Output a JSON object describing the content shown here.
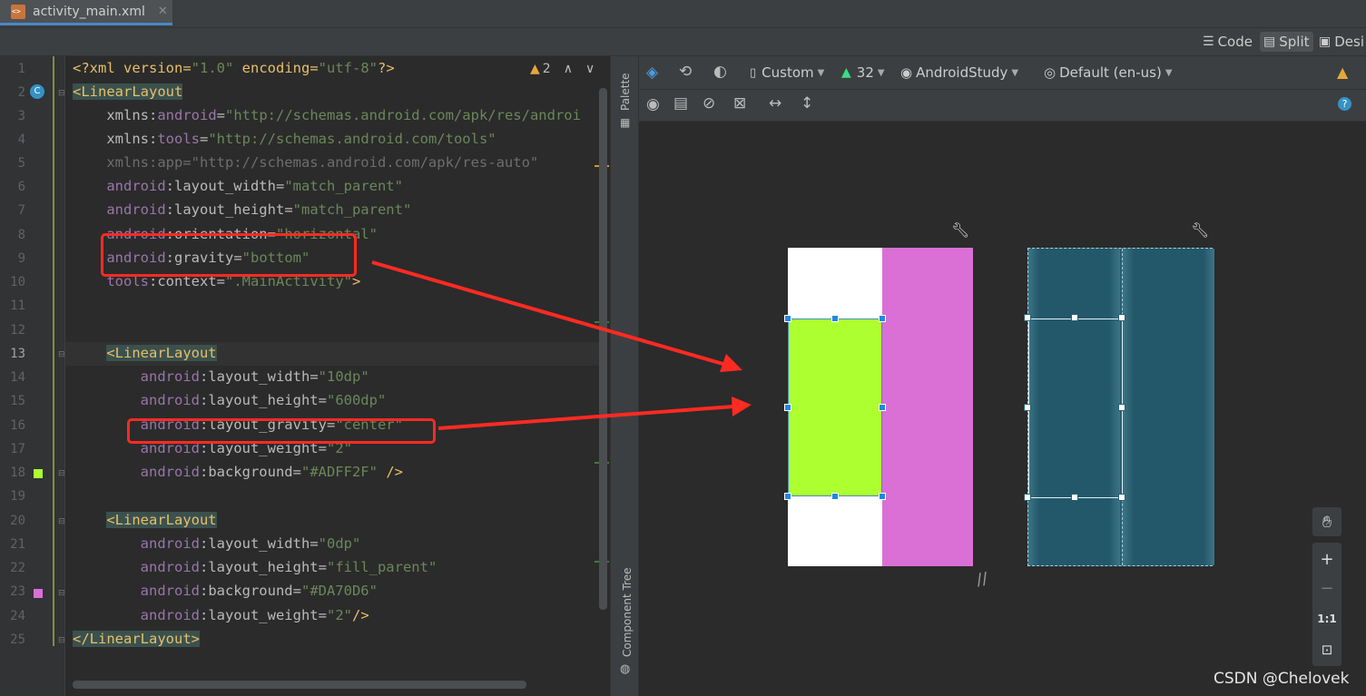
{
  "tab": {
    "filename": "activity_main.xml",
    "close": "✕"
  },
  "modes": {
    "code": "Code",
    "split": "Split",
    "design": "Desi"
  },
  "inspection": {
    "count": "2"
  },
  "lines": [
    "1",
    "2",
    "3",
    "4",
    "5",
    "6",
    "7",
    "8",
    "9",
    "10",
    "11",
    "12",
    "13",
    "14",
    "15",
    "16",
    "17",
    "18",
    "19",
    "20",
    "21",
    "22",
    "23",
    "24",
    "25"
  ],
  "code": {
    "l1": {
      "a": "<?xml version=",
      "b": "\"1.0\"",
      "c": " encoding=",
      "d": "\"utf-8\"",
      "e": "?>"
    },
    "l2": {
      "tag": "<LinearLayout"
    },
    "l3": {
      "ns": "xmlns:",
      "attr": "android",
      "eq": "=",
      "val": "\"http://schemas.android.com/apk/res/androi"
    },
    "l4": {
      "ns": "xmlns:",
      "attr": "tools",
      "eq": "=",
      "val": "\"http://schemas.android.com/tools\""
    },
    "l5": {
      "text": "xmlns:app=\"http://schemas.android.com/apk/res-auto\""
    },
    "l6": {
      "ns": "android",
      "attr": ":layout_width",
      "eq": "=",
      "val": "\"match_parent\""
    },
    "l7": {
      "ns": "android",
      "attr": ":layout_height",
      "eq": "=",
      "val": "\"match_parent\""
    },
    "l8": {
      "ns": "android",
      "attr": ":orientation",
      "eq": "=",
      "val": "\"horizontal\""
    },
    "l9": {
      "ns": "android",
      "attr": ":gravity",
      "eq": "=",
      "val": "\"bottom\""
    },
    "l10": {
      "ns": "tools",
      "attr": ":context",
      "eq": "=",
      "val": "\".MainActivity\"",
      "end": ">"
    },
    "l13": {
      "tag": "<LinearLayout"
    },
    "l14": {
      "ns": "android",
      "attr": ":layout_width",
      "eq": "=",
      "val": "\"10dp\""
    },
    "l15": {
      "ns": "android",
      "attr": ":layout_height",
      "eq": "=",
      "val": "\"600dp\""
    },
    "l16": {
      "ns": "android",
      "attr": ":layout_gravity",
      "eq": "=",
      "val": "\"center\""
    },
    "l17": {
      "ns": "android",
      "attr": ":layout_weight",
      "eq": "=",
      "val": "\"2\""
    },
    "l18": {
      "ns": "android",
      "attr": ":background",
      "eq": "=",
      "val": "\"#ADFF2F\"",
      "end": " />"
    },
    "l20": {
      "tag": "<LinearLayout"
    },
    "l21": {
      "ns": "android",
      "attr": ":layout_width",
      "eq": "=",
      "val": "\"0dp\""
    },
    "l22": {
      "ns": "android",
      "attr": ":layout_height",
      "eq": "=",
      "val": "\"fill_parent\""
    },
    "l23": {
      "ns": "android",
      "attr": ":background",
      "eq": "=",
      "val": "\"#DA70D6\""
    },
    "l24": {
      "ns": "android",
      "attr": ":layout_weight",
      "eq": "=",
      "val": "\"2\"",
      "end": "/>"
    },
    "l25": {
      "tag": "</LinearLayout>"
    }
  },
  "side_panels": {
    "palette": "Palette",
    "component_tree": "Component Tree"
  },
  "design_toolbar": {
    "device": "Custom",
    "api": "32",
    "theme": "AndroidStudy",
    "locale": "Default (en-us)"
  },
  "colors": {
    "green": "#ADFF2F",
    "magenta": "#DA70D6",
    "accent": "#4a88c7",
    "highlight": "#ff2a22"
  },
  "zoom": {
    "zoom_in": "+",
    "zoom_out": "−",
    "actual_size": "1:1"
  },
  "watermark": "CSDN @Chelovek"
}
